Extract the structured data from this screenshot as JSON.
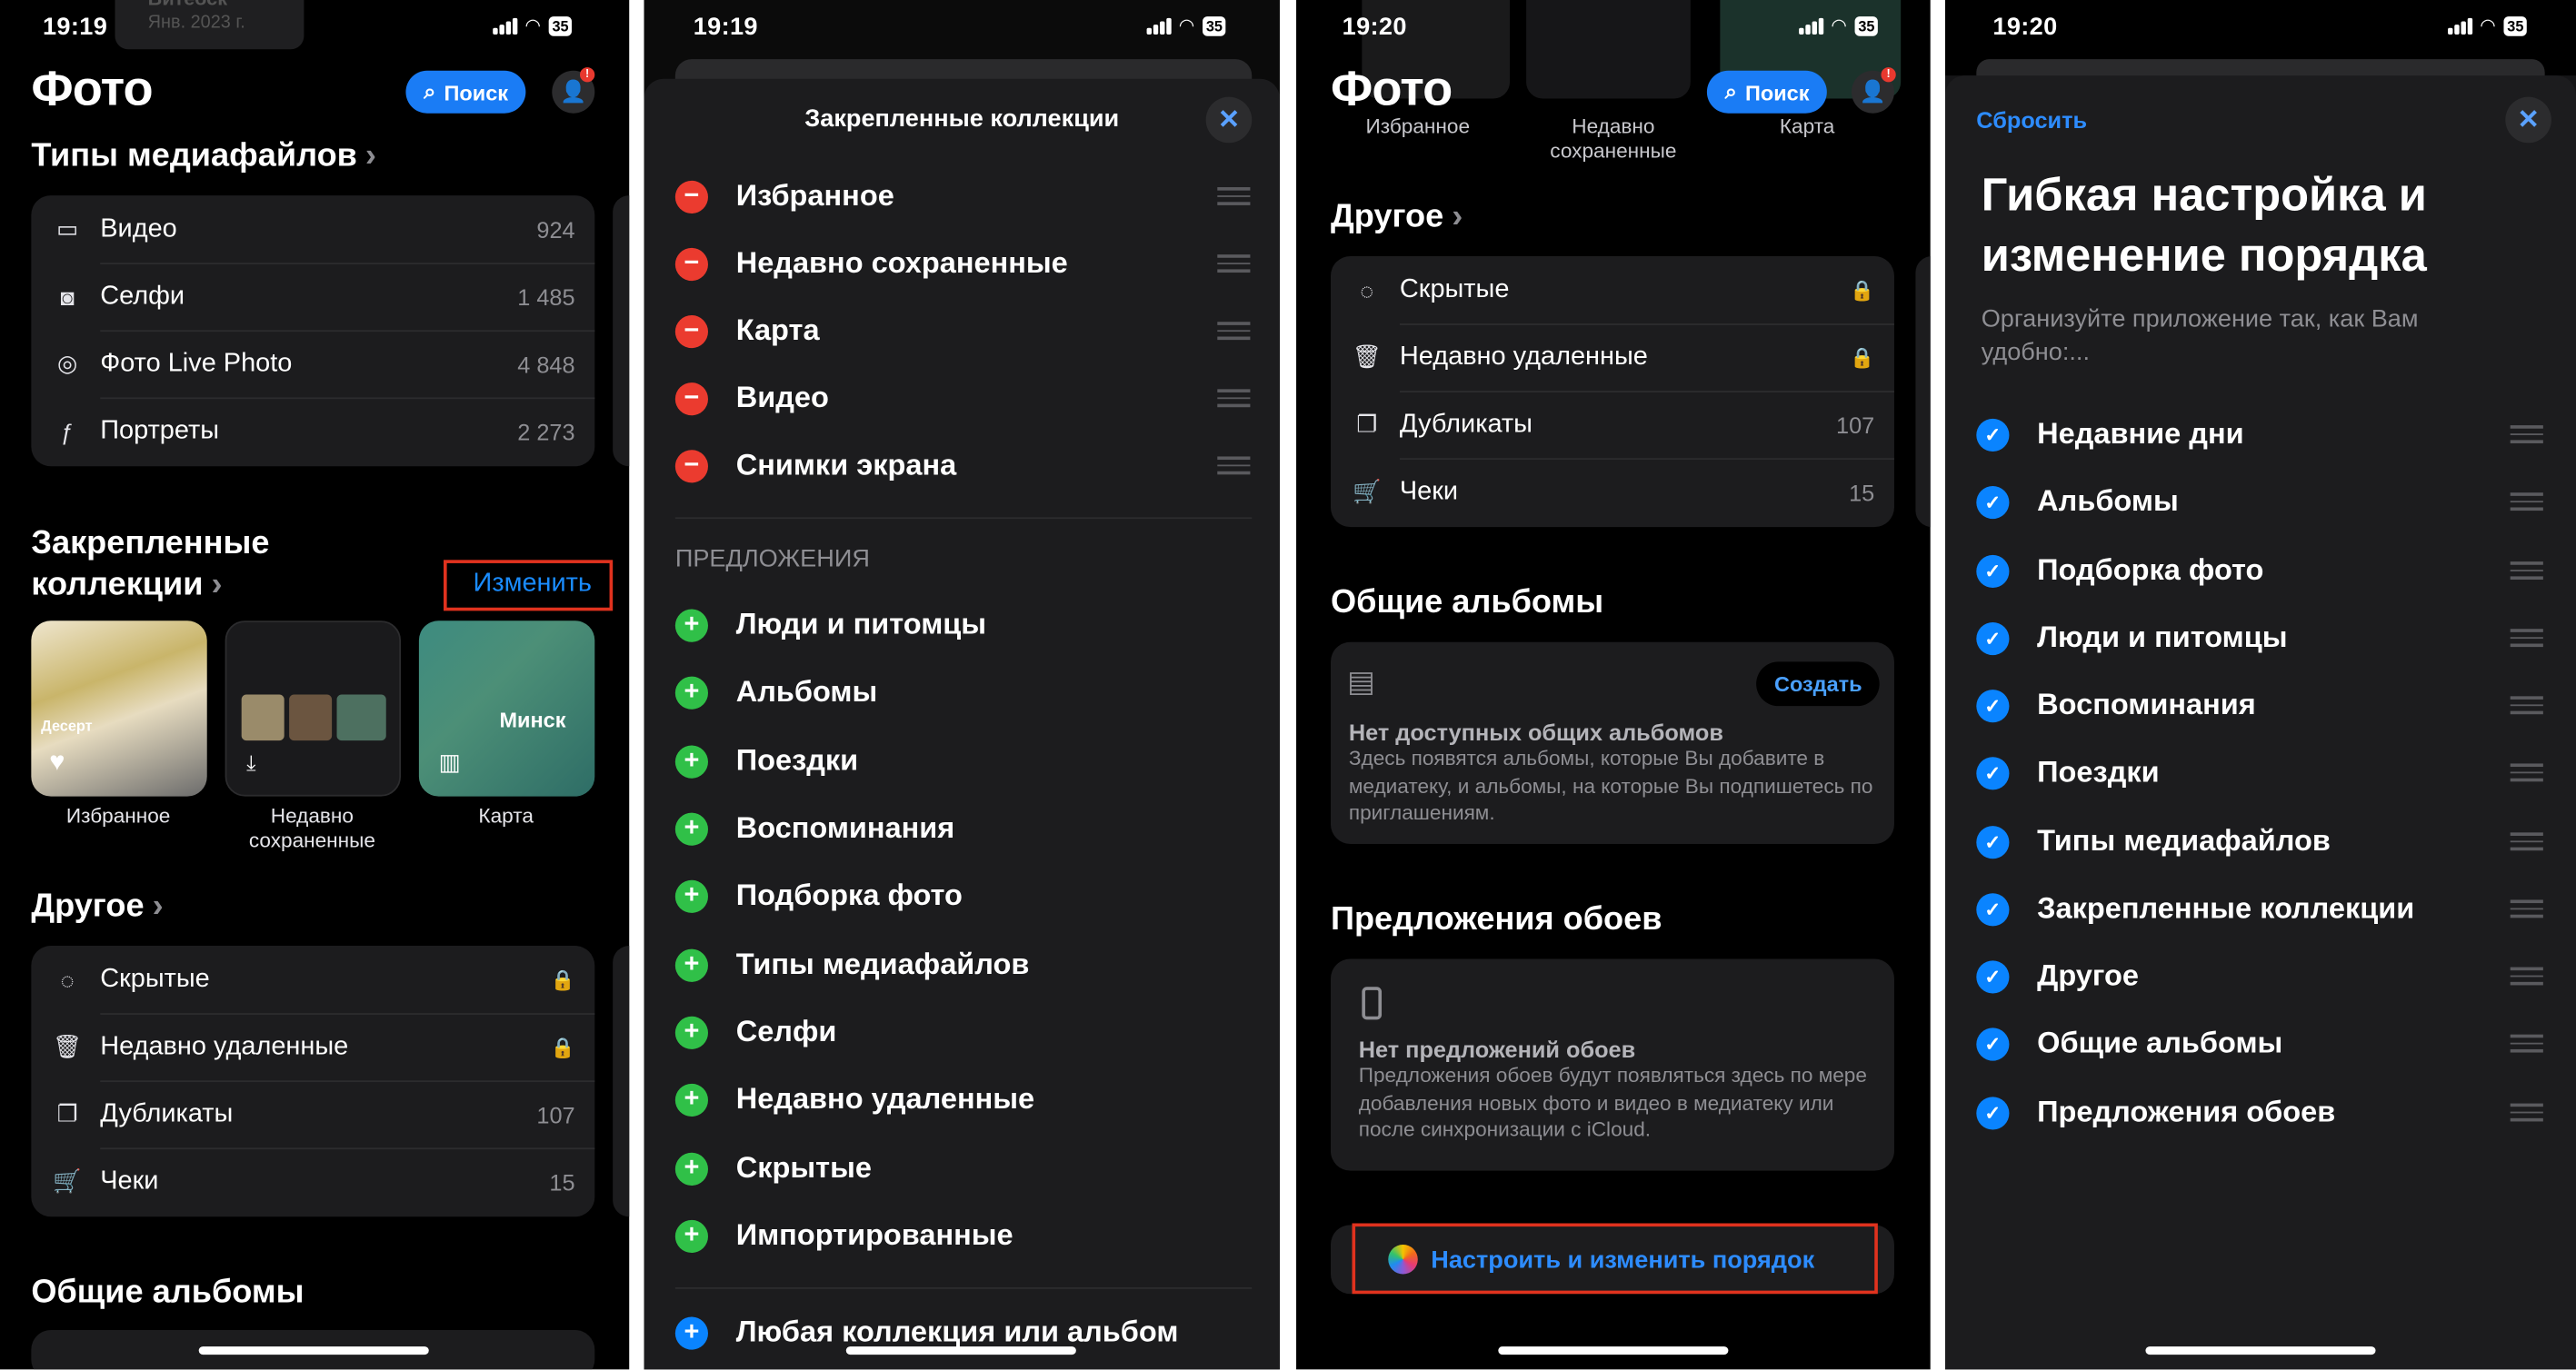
{
  "panel1": {
    "time": "19:19",
    "battery": "35",
    "title": "Фото",
    "search_label": "Поиск",
    "badge": "!",
    "media_types_header": "Типы медиафайлов",
    "media": [
      {
        "label": "Видео",
        "count": "924"
      },
      {
        "label": "Селфи",
        "count": "1 485"
      },
      {
        "label": "Фото Live Photo",
        "count": "4 848"
      },
      {
        "label": "Портреты",
        "count": "2 273"
      }
    ],
    "pinned_header_line1": "Закрепленные",
    "pinned_header_line2": "коллекции",
    "edit_label": "Изменить",
    "thumb_caption_dessert": "Десерт",
    "thumb_map_city": "Минск",
    "thumb_top_text": "Витебск",
    "thumb_top_date": "Янв. 2023 г.",
    "tiles": [
      {
        "label": "Избранное"
      },
      {
        "label": "Недавно сохраненные"
      },
      {
        "label": "Карта"
      }
    ],
    "other_header": "Другое",
    "other": [
      {
        "label": "Скрытые",
        "count": ""
      },
      {
        "label": "Недавно удаленные",
        "count": ""
      },
      {
        "label": "Дубликаты",
        "count": "107"
      },
      {
        "label": "Чеки",
        "count": "15"
      }
    ],
    "shared_header": "Общие альбомы"
  },
  "panel2": {
    "time": "19:19",
    "battery": "35",
    "title": "Закрепленные коллекции",
    "pinned": [
      "Избранное",
      "Недавно сохраненные",
      "Карта",
      "Видео",
      "Снимки экрана"
    ],
    "suggestions_header": "ПРЕДЛОЖЕНИЯ",
    "suggestions": [
      "Люди и питомцы",
      "Альбомы",
      "Поездки",
      "Воспоминания",
      "Подборка фото",
      "Типы медиафайлов",
      "Селфи",
      "Недавно удаленные",
      "Скрытые",
      "Импортированные"
    ],
    "any_label": "Любая коллекция или альбом"
  },
  "panel3": {
    "time": "19:20",
    "battery": "35",
    "title": "Фото",
    "search_label": "Поиск",
    "badge": "!",
    "top_tiles": [
      {
        "label": "Избранное"
      },
      {
        "label": "Недавно сохраненные"
      },
      {
        "label": "Карта"
      }
    ],
    "other_header": "Другое",
    "other": [
      {
        "label": "Скрытые",
        "count": ""
      },
      {
        "label": "Недавно удаленные",
        "count": ""
      },
      {
        "label": "Дубликаты",
        "count": "107"
      },
      {
        "label": "Чеки",
        "count": "15"
      }
    ],
    "shared_header": "Общие альбомы",
    "create_label": "Создать",
    "shared_empty_title": "Нет доступных общих альбомов",
    "shared_empty_text": "Здесь появятся альбомы, которые Вы добавите в медиатеку, и альбомы, на которые Вы подпишетесь по приглашениям.",
    "wall_header": "Предложения обоев",
    "wall_empty_title": "Нет предложений обоев",
    "wall_empty_text": "Предложения обоев будут появляться здесь по мере добавления новых фото и видео в медиатеку или после синхронизации с iCloud.",
    "customize_label": "Настроить и изменить порядок"
  },
  "panel4": {
    "time": "19:20",
    "battery": "35",
    "reset_label": "Сбросить",
    "title": "Гибкая настройка и изменение порядка",
    "subtitle": "Организуйте приложение так, как Вам удобно:...",
    "items": [
      "Недавние дни",
      "Альбомы",
      "Подборка фото",
      "Люди и питомцы",
      "Воспоминания",
      "Поездки",
      "Типы медиафайлов",
      "Закрепленные коллекции",
      "Другое",
      "Общие альбомы",
      "Предложения обоев"
    ]
  },
  "colors": {
    "accent": "#0a84ff",
    "remove": "#eb3b2f",
    "add": "#30c048",
    "highlight": "#e0321e"
  }
}
